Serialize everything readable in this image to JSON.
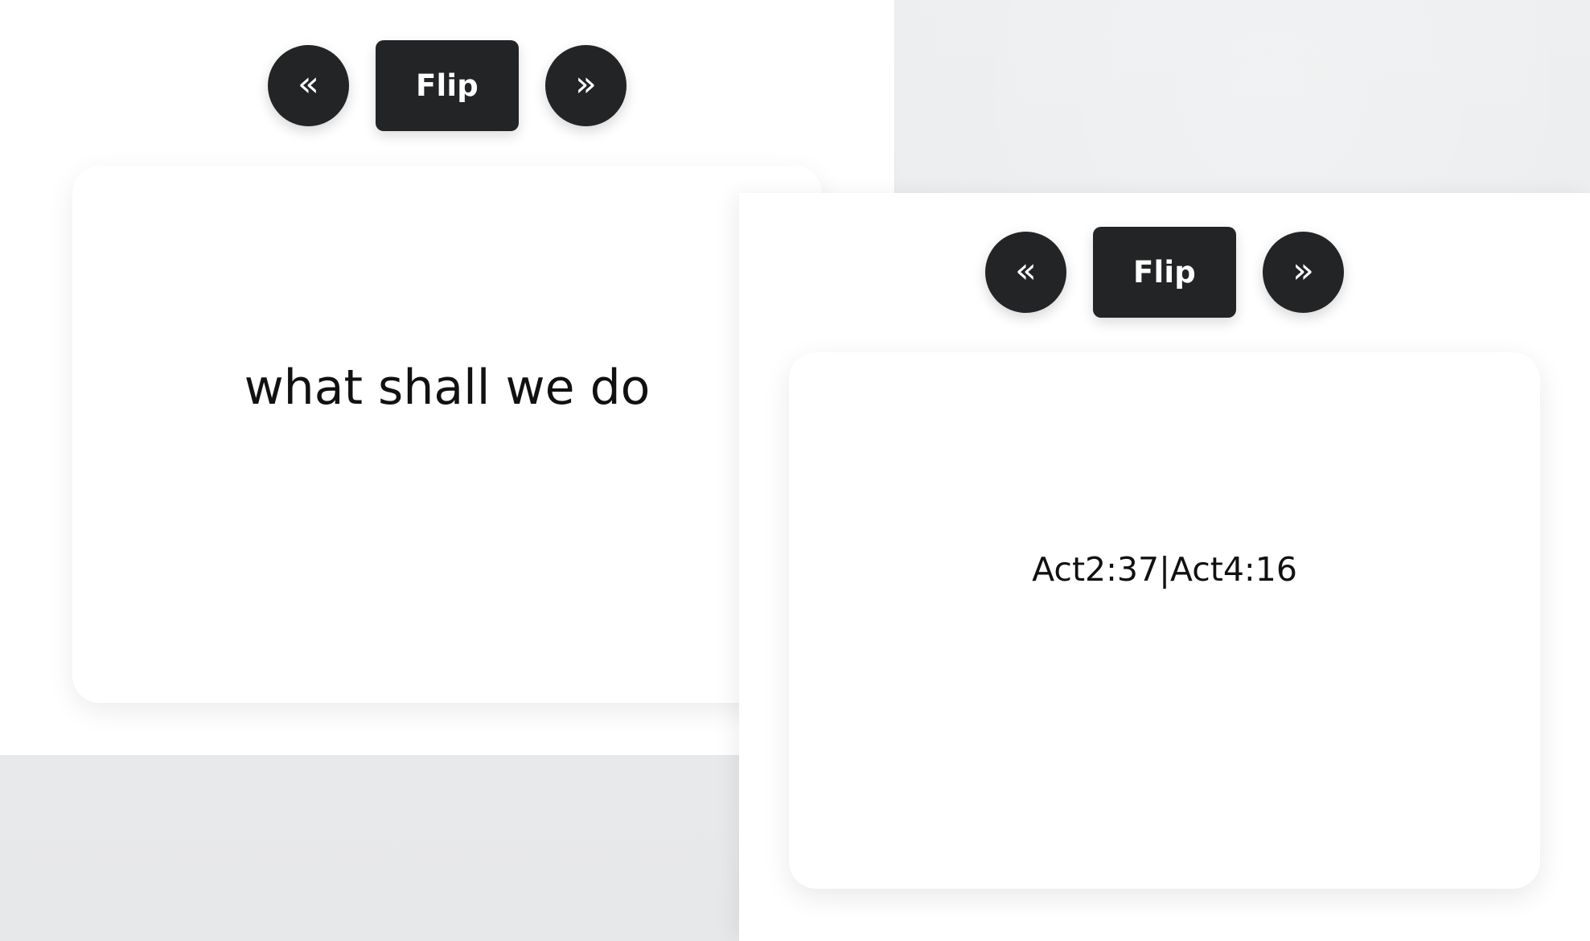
{
  "colors": {
    "background": "#e9eaec",
    "panel": "#ffffff",
    "button": "#222426",
    "button_text": "#ffffff",
    "card_text": "#111111"
  },
  "left": {
    "controls": {
      "prev_icon": "«",
      "flip_label": "Flip",
      "next_icon": "»"
    },
    "card": {
      "text": "what shall we do"
    }
  },
  "right": {
    "controls": {
      "prev_icon": "«",
      "flip_label": "Flip",
      "next_icon": "»"
    },
    "card": {
      "text": "Act2:37|Act4:16"
    }
  },
  "icons": {
    "previous": "double-left-chevron-icon",
    "next": "double-right-chevron-icon"
  }
}
